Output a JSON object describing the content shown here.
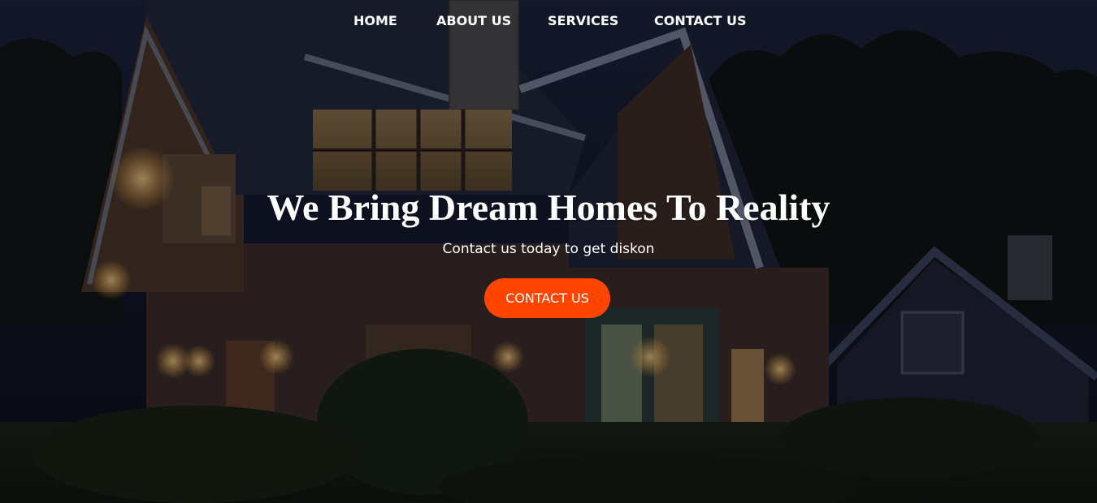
{
  "nav": {
    "items": [
      {
        "label": "HOME"
      },
      {
        "label": "ABOUT US"
      },
      {
        "label": "SERVICES"
      },
      {
        "label": "CONTACT US"
      }
    ]
  },
  "hero": {
    "headline": "We Bring Dream Homes To Reality",
    "subtitle": "Contact us today to get diskon",
    "cta_label": "CONTACT US",
    "background_icon": "house-at-night-photo"
  },
  "colors": {
    "cta": "#ff4500",
    "text": "#ffffff",
    "overlay": "#0b0f1c"
  }
}
